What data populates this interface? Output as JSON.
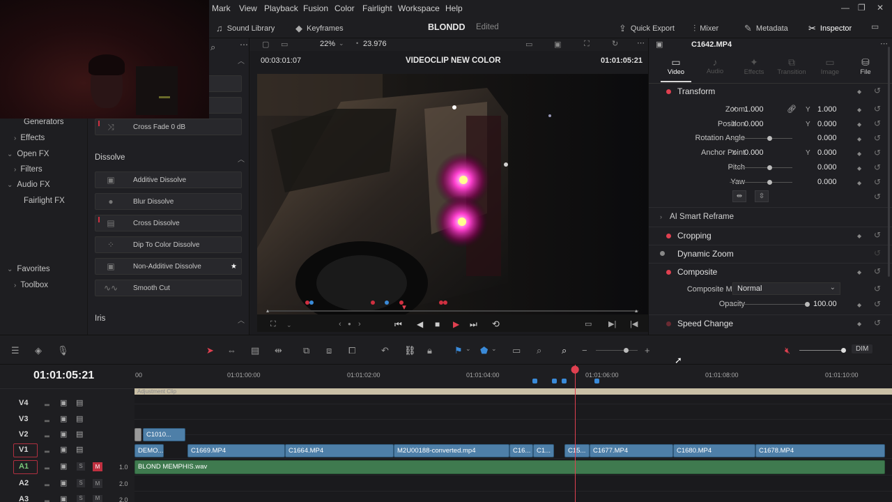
{
  "menu": {
    "items": [
      "Mark",
      "View",
      "Playback",
      "Fusion",
      "Color",
      "Fairlight",
      "Workspace",
      "Help"
    ]
  },
  "toolbar": {
    "sound_library": "Sound Library",
    "keyframes": "Keyframes",
    "project_name": "BLONDD",
    "project_status": "Edited",
    "quick_export": "Quick Export",
    "mixer": "Mixer",
    "metadata": "Metadata",
    "inspector": "Inspector"
  },
  "left_nav": {
    "items": [
      "Generators",
      "Effects",
      "Open FX",
      "Filters",
      "Audio FX",
      "Fairlight FX",
      "Favorites",
      "Toolbox"
    ]
  },
  "fx": {
    "crossfade": "Cross Fade 0 dB",
    "dissolve_header": "Dissolve",
    "dissolve_items": [
      "Additive Dissolve",
      "Blur Dissolve",
      "Cross Dissolve",
      "Dip To Color Dissolve",
      "Non-Additive Dissolve",
      "Smooth Cut"
    ],
    "iris_header": "Iris"
  },
  "viewer": {
    "zoom": "22%",
    "fps": "23.976",
    "duration": "00:03:01:07",
    "title": "VIDEOCLIP NEW COLOR",
    "timecode": "01:01:05:21"
  },
  "inspector": {
    "clip_name": "C1642.MP4",
    "tabs": [
      "Video",
      "Audio",
      "Effects",
      "Transition",
      "Image",
      "File"
    ],
    "transform": "Transform",
    "zoom_label": "Zoom",
    "zoom_x": "1.000",
    "zoom_y": "1.000",
    "position_label": "Position",
    "position_x": "0.000",
    "position_y": "0.000",
    "rotation_label": "Rotation Angle",
    "rotation": "0.000",
    "anchor_label": "Anchor Point",
    "anchor_x": "0.000",
    "anchor_y": "0.000",
    "pitch_label": "Pitch",
    "pitch": "0.000",
    "yaw_label": "Yaw",
    "yaw": "0.000",
    "flip_label": "Flip",
    "x": "X",
    "y": "Y",
    "smart_reframe": "AI Smart Reframe",
    "cropping": "Cropping",
    "dynamic_zoom": "Dynamic Zoom",
    "composite": "Composite",
    "composite_mode_label": "Composite Mode",
    "composite_mode": "Normal",
    "opacity_label": "Opacity",
    "opacity": "100.00",
    "speed_change": "Speed Change"
  },
  "timeline": {
    "timecode": "01:01:05:21",
    "dim": "DIM",
    "ruler": [
      "00",
      "01:01:00:00",
      "01:01:02:00",
      "01:01:04:00",
      "01:01:06:00",
      "01:01:08:00",
      "01:01:10:00"
    ],
    "tracks": [
      "V4",
      "V3",
      "V2",
      "V1",
      "A1",
      "A2",
      "A3"
    ],
    "track_levels": [
      "1.0",
      "2.0",
      "2.0"
    ],
    "adjustment_clip": "Adjustment Clip",
    "v2_clip": "C1010...",
    "v1_clips": [
      "DEMO...",
      "C1669.MP4",
      "C1664.MP4",
      "M2U00188-converted.mp4",
      "C16...",
      "C1...",
      "C15...",
      "C1677.MP4",
      "C1680.MP4",
      "C1678.MP4"
    ],
    "audio_clip": "BLOND MEMPHIS.wav"
  }
}
